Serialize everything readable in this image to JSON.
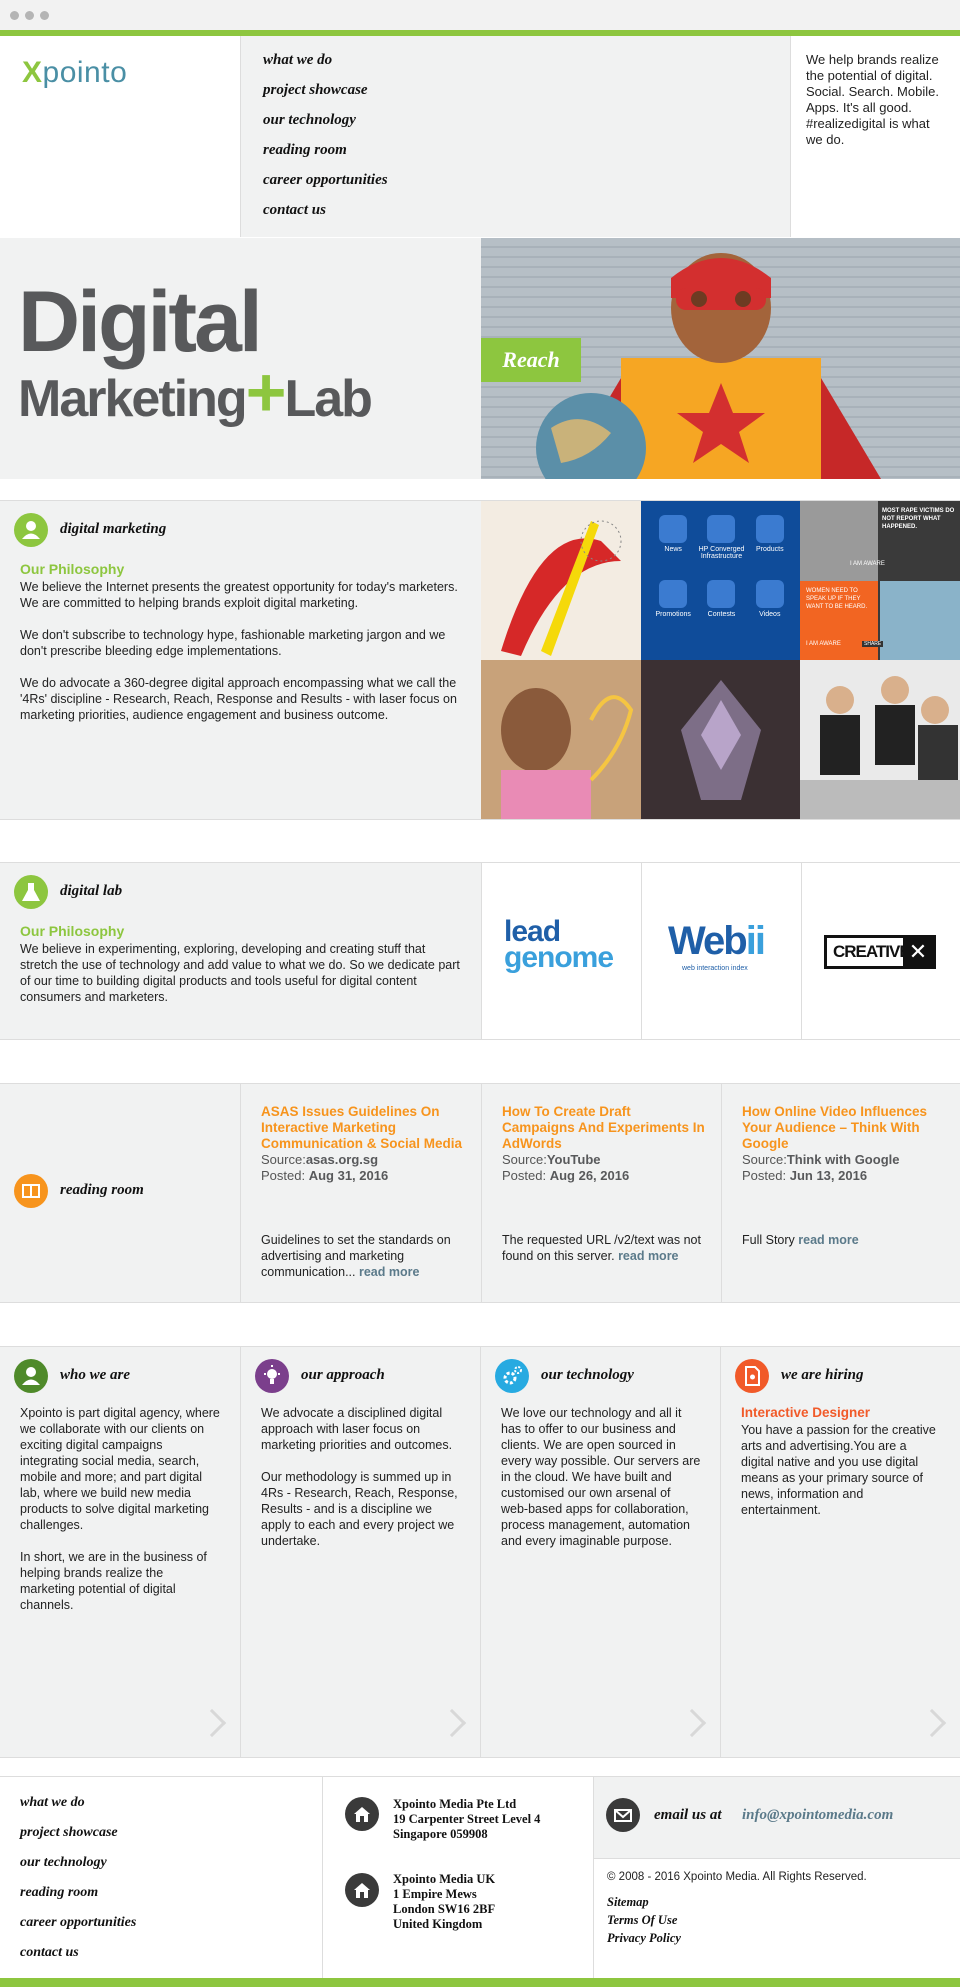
{
  "logo": {
    "brand": "pointo",
    "x": "X"
  },
  "nav": [
    "what we do",
    "project showcase",
    "our technology",
    "reading room",
    "career opportunities",
    "contact us"
  ],
  "tagline": "We help brands realize the potential of digital. Social. Search. Mobile. Apps. It's all good. #realizedigital is what we do.",
  "hero": {
    "line1": "Digital",
    "line2a": "Marketing",
    "plus": "+",
    "line2b": "Lab",
    "badge": "Reach"
  },
  "digital_marketing": {
    "heading": "digital marketing",
    "subheading": "Our Philosophy",
    "p1": "We believe the Internet presents the greatest opportunity for today's marketers. We are committed to helping brands exploit digital marketing.",
    "p2": "We don't subscribe to technology hype, fashionable marketing jargon and we don't prescribe bleeding edge implementations.",
    "p3": "We do advocate a 360-degree digital approach encompassing what we call the '4Rs' discipline - Research, Reach, Response and Results - with laser focus on marketing priorities, audience engagement and business outcome.",
    "tile_labels": [
      "News",
      "HP Converged Infrastructure",
      "Products",
      "Promotions",
      "Contests",
      "Videos"
    ],
    "tile_headline": "MOST RAPE VICTIMS DO NOT REPORT WHAT HAPPENED.",
    "tile_sub": "WOMEN NEED TO SPEAK UP IF THEY WANT TO BE HEARD.",
    "tile_aware": "I AM AWARE",
    "tile_share": "SHARE"
  },
  "digital_lab": {
    "heading": "digital lab",
    "subheading": "Our Philosophy",
    "body": "We believe in experimenting, exploring, developing and creating stuff that stretch the use of technology and add value to what we do. So we dedicate part of our time to building digital products and tools useful for digital content consumers and marketers.",
    "logo1a": "lead",
    "logo1b": "genome",
    "logo2a": "Web",
    "logo2b": "ii",
    "logo2sub": "web interaction index",
    "logo3": "CREATIVE"
  },
  "reading_room": {
    "heading": "reading room",
    "source_label": "Source:",
    "posted_label": "Posted:",
    "read_more": "read more",
    "articles": [
      {
        "title": "ASAS Issues Guidelines On Interactive Marketing Communication & Social Media",
        "source": "asas.org.sg",
        "posted": "Aug 31, 2016",
        "excerpt": "Guidelines to set the standards on advertising and marketing communication..."
      },
      {
        "title": "How To Create Draft Campaigns And Experiments In AdWords",
        "source": "YouTube",
        "posted": "Aug 26, 2016",
        "excerpt": "The requested URL /v2/text was not found on this server."
      },
      {
        "title": "How Online Video Influences Your Audience – Think With Google",
        "source": "Think with Google",
        "posted": "Jun 13, 2016",
        "excerpt": "Full Story"
      }
    ]
  },
  "who_we_are": {
    "heading": "who we are",
    "p1": "Xpointo is part digital agency, where we collaborate with our clients on exciting digital campaigns integrating social media, search, mobile and more; and part digital lab, where we build new media products to solve digital marketing challenges.",
    "p2": "In short, we are in the business of helping brands realize the marketing potential of digital channels."
  },
  "our_approach": {
    "heading": "our approach",
    "p1": "We advocate a disciplined digital approach with laser focus on marketing priorities and outcomes.",
    "p2": "Our methodology is summed up in 4Rs - Research, Reach, Response, Results - and is a discipline we apply to each and every project we undertake."
  },
  "our_technology": {
    "heading": "our technology",
    "p1": "We love our technology and all it has to offer to our business and clients. We are open sourced in every way possible. Our servers are in the cloud. We have built and customised our own arsenal of web-based apps for collaboration, process management, automation and every imaginable purpose."
  },
  "hiring": {
    "heading": "we are hiring",
    "role": "Interactive Designer",
    "p1": "You have a passion for the creative arts and advertising.You are a digital native and you use digital means as your primary source of news, information and entertainment."
  },
  "footer": {
    "nav": [
      "what we do",
      "project showcase",
      "our technology",
      "reading room",
      "career opportunities",
      "contact us"
    ],
    "addr1": [
      "Xpointo Media Pte Ltd",
      "19 Carpenter Street Level 4",
      "Singapore 059908"
    ],
    "addr2": [
      "Xpointo Media UK",
      "1 Empire Mews",
      "London SW16 2BF",
      "United Kingdom"
    ],
    "email_label": "email us at",
    "email": "info@xpointomedia.com",
    "copyright": "© 2008 - 2016 Xpointo Media. All Rights Reserved.",
    "links": [
      "Sitemap",
      "Terms Of Use",
      "Privacy Policy"
    ]
  },
  "colors": {
    "green": "#8dc63f",
    "orange": "#f7941d",
    "purple": "#7b3f8c",
    "teal": "#27aae1",
    "red": "#f15a29",
    "gray_bg": "#f1f2f2"
  },
  "icons": [
    "user-icon",
    "flask-icon",
    "book-icon",
    "bulb-icon",
    "gear-icon",
    "document-icon",
    "house-icon",
    "envelope-icon",
    "chevron-right-icon"
  ]
}
